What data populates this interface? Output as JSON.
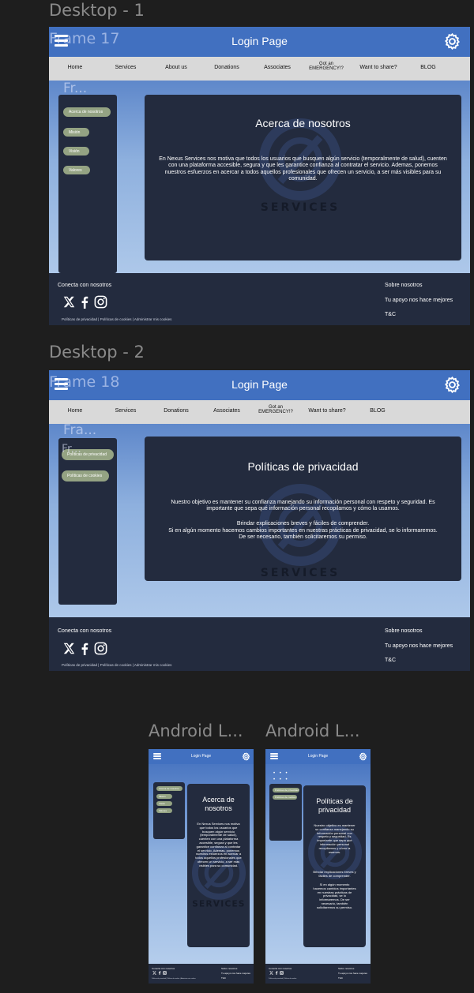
{
  "canvas": {
    "desktop1_label": "Desktop - 1",
    "desktop2_label": "Desktop - 2",
    "android1_label": "Android L...",
    "android2_label": "Android L..."
  },
  "desktop1": {
    "frame_tag": "Frame 17",
    "inner_tag": "Fr...",
    "title": "Login Page",
    "nav": [
      "Home",
      "Services",
      "About us",
      "Donations",
      "Associates",
      "Got an EMERGENCY!?",
      "Want to share?",
      "BLOG"
    ],
    "sidebar": [
      "Acerca de nosotros",
      "Misión",
      "Visión",
      "Valores"
    ],
    "panel_title": "Acerca de nosotros",
    "panel_body": "En  Nexus Services nos motiva que todos los usuarios que busquen algún servicio (temporalmente de salud),  cuenten con una plataforma accesible, segura y que les garantice confianza al contratar el servicio. Ademas, ponemos nuestros esfuerzos en acercar a todos aquellos profesionales que ofrecen un servicio, a ser más visibles para su comunidad.",
    "watermark": "SERVICES"
  },
  "desktop2": {
    "frame_tag": "Frame 18",
    "inner_tag": "Fra...",
    "inner_tag2": "Fr...",
    "title": "Login Page",
    "nav": [
      "Home",
      "Services",
      "Donations",
      "Associates",
      "Got an EMERGENCY!?",
      "Want to share?",
      "BLOG"
    ],
    "sidebar": [
      "Políticas de privacidad",
      "Políticas de cookies"
    ],
    "panel_title": "Políticas de privacidad",
    "panel_body_1": "Nuestro objetivo es mantener su confianza manejando su información personal con respeto y seguridad. Es importante que sepa qué información personal recopilamos y cómo la usamos.",
    "panel_body_2": "Brindar explicaciones breves y fáciles de comprender.",
    "panel_body_3": "Si en algún momento hacemos cambios importantes en nuestras prácticas de privacidad, se lo informaremos. De ser necesario, también solicitaremos su permiso.",
    "watermark": "SERVICES"
  },
  "footer": {
    "connect": "Conecta con nosotros",
    "about": "Sobre nosotros",
    "support": "Tu apoyo nos hace mejores",
    "tc": "T&C",
    "legal": "Políticas de privacidad | Políticas de cookies | Administrar mis cookies",
    "legal_short": "Políticas de privacidad | Políticas de cookies"
  },
  "android1": {
    "title": "Login Page",
    "sidebar": [
      "Acerca de nosotros",
      "Misión",
      "Visión",
      "Valores"
    ],
    "panel_title": "Acerca de nosotros",
    "panel_body": "En  Nexus Services nos motiva que todos los usuarios que busquen algún servicio (temporalmente de salud),  cuenten con una plataforma accesible, segura y que les garantice confianza al contratar el servicio. Ademas, ponemos nuestros esfuerzos en acercar a todos aquellos profesionales que ofrecen un servicio, a ser más visibles para su comunidad.",
    "watermark": "SERVICES"
  },
  "android2": {
    "title": "Login Page",
    "dots": "• • •",
    "sidebar": [
      "Políticas de privacidad",
      "Políticas de cookies"
    ],
    "panel_title": "Políticas de privacidad",
    "panel_body_1": "Nuestro objetivo es mantener su confianza manejando su información personal con respeto y seguridad. Es importante que sepa qué información personal recopilamos y cómo la usamos.",
    "panel_body_2": "Brindar explicaciones breves y fáciles de comprender.",
    "panel_body_3": "Si en algún momento hacemos cambios importantes en nuestras prácticas de privacidad, se lo informaremos. De ser necesario, también solicitaremos su permiso."
  },
  "colors": {
    "topbar": "#4170c0",
    "navbar": "#d9d9d9",
    "panel": "#232b3e",
    "pill": "#94a383",
    "canvas": "#1e1e1e"
  },
  "icons": [
    "hamburger-icon",
    "gear-icon",
    "x-icon",
    "facebook-icon",
    "instagram-icon",
    "services-logo"
  ]
}
